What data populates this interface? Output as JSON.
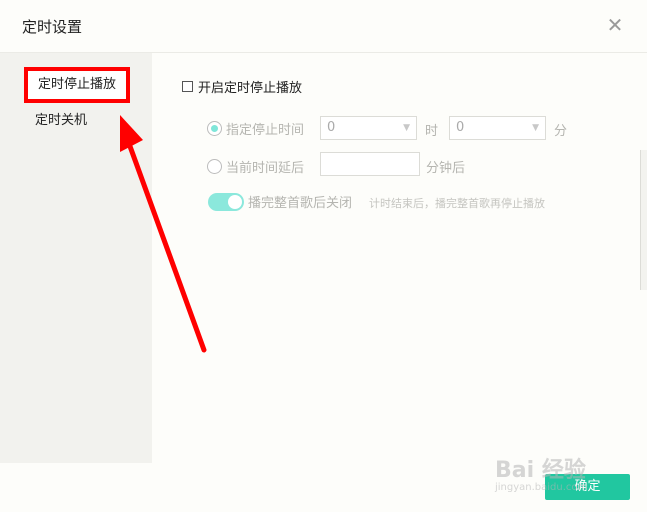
{
  "dialog": {
    "title": "定时设置",
    "close_label": "✕"
  },
  "sidebar": {
    "items": [
      {
        "label": "定时停止播放",
        "active": true
      },
      {
        "label": "定时关机",
        "active": false
      }
    ]
  },
  "main": {
    "enable_label": "开启定时停止播放",
    "option1": {
      "label": "指定停止时间",
      "hour_value": "0",
      "hour_unit": "时",
      "minute_value": "0",
      "minute_unit": "分"
    },
    "option2": {
      "label": "当前时间延后",
      "unit": "分钟后"
    },
    "toggle": {
      "label": "播完整首歌后关闭",
      "hint": "计时结束后，播完整首歌再停止播放"
    }
  },
  "footer": {
    "ok_label": "确定"
  },
  "watermark": {
    "text": "Bai 经验",
    "sub": "jingyan.baidu.com"
  },
  "colors": {
    "accent": "#21c7a0",
    "annotation": "#ff0000",
    "toggle": "#8be8dc"
  }
}
